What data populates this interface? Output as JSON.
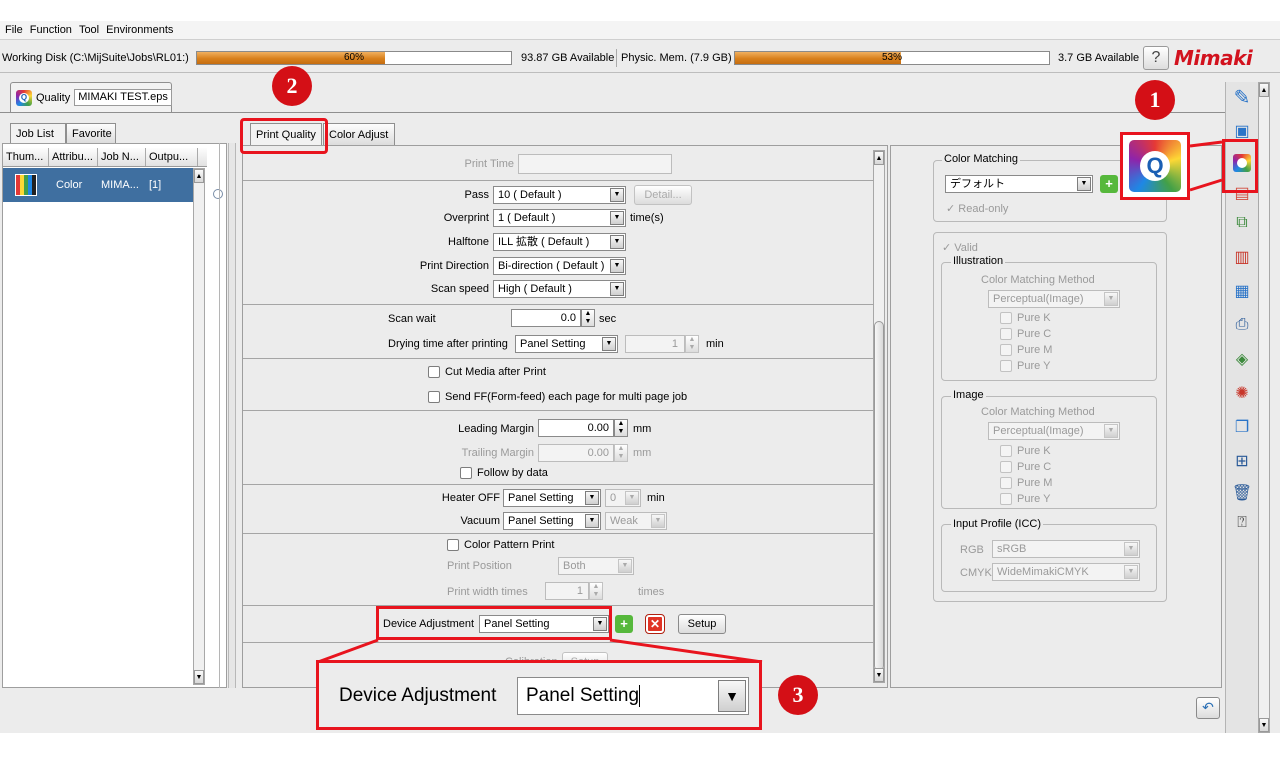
{
  "menu": [
    "File",
    "Function",
    "Tool",
    "Environments"
  ],
  "status": {
    "working_disk_label": "Working Disk (C:\\MijSuite\\Jobs\\RL01:)",
    "working_disk_percent_text": "60%",
    "working_disk_percent": 60,
    "working_disk_available": "93.87 GB Available",
    "phys_mem_label": "Physic. Mem. (7.9 GB)",
    "phys_mem_percent_text": "53%",
    "phys_mem_percent": 53,
    "phys_mem_available": "3.7 GB Available",
    "help_label": "?",
    "logo": "Mimaki"
  },
  "doc_tab": {
    "mode": "Quality",
    "filename": "MIMAKI TEST.eps"
  },
  "left_tabs": [
    "Job List",
    "Favorite"
  ],
  "job_list": {
    "columns": [
      "Thum...",
      "Attribu...",
      "Job N...",
      "Outpu..."
    ],
    "rows": [
      {
        "attribute": "Color",
        "job_name": "MIMA...",
        "output": "[1]"
      }
    ]
  },
  "center_tabs": [
    "Print Quality",
    "Color Adjust"
  ],
  "print_quality": {
    "print_time_label": "Print Time",
    "pass_label": "Pass",
    "pass_value": "10 ( Default )",
    "detail_button": "Detail...",
    "overprint_label": "Overprint",
    "overprint_value": "1 ( Default )",
    "overprint_unit": "time(s)",
    "halftone_label": "Halftone",
    "halftone_value": "ILL 拡散 ( Default )",
    "print_direction_label": "Print Direction",
    "print_direction_value": "Bi-direction ( Default )",
    "scan_speed_label": "Scan speed",
    "scan_speed_value": "High ( Default )",
    "scan_wait_label": "Scan wait",
    "scan_wait_value": "0.0",
    "scan_wait_unit": "sec",
    "drying_label": "Drying time after printing",
    "drying_value": "Panel Setting",
    "drying_minutes": "1",
    "drying_unit": "min",
    "cut_media_label": "Cut Media after Print",
    "send_ff_label": "Send FF(Form-feed) each page for multi page job",
    "leading_margin_label": "Leading Margin",
    "leading_margin_value": "0.00",
    "leading_margin_unit": "mm",
    "trailing_margin_label": "Trailing Margin",
    "trailing_margin_value": "0.00",
    "trailing_margin_unit": "mm",
    "follow_by_data_label": "Follow by data",
    "heater_off_label": "Heater OFF",
    "heater_off_value": "Panel Setting",
    "heater_off_minutes": "0",
    "heater_off_unit": "min",
    "vacuum_label": "Vacuum",
    "vacuum_value": "Panel Setting",
    "vacuum_level": "Weak",
    "color_pattern_label": "Color Pattern Print",
    "print_position_label": "Print Position",
    "print_position_value": "Both",
    "print_width_label": "Print width times",
    "print_width_value": "1",
    "print_width_unit": "times",
    "device_adjustment_label": "Device Adjustment",
    "device_adjustment_value": "Panel Setting",
    "setup_button": "Setup",
    "calibration_label": "Calibration",
    "calibration_button": "Setup"
  },
  "color_panel": {
    "color_matching_title": "Color Matching",
    "color_matching_value": "デフォルト",
    "read_only_label": "Read-only",
    "valid_label": "Valid",
    "illustration_title": "Illustration",
    "illustration_method_label": "Color Matching Method",
    "illustration_method_value": "Perceptual(Image)",
    "image_title": "Image",
    "image_method_label": "Color Matching Method",
    "image_method_value": "Perceptual(Image)",
    "pure_items": [
      "Pure K",
      "Pure C",
      "Pure M",
      "Pure Y"
    ],
    "input_profile_title": "Input Profile (ICC)",
    "rgb_label": "RGB",
    "rgb_value": "sRGB",
    "cmyk_label": "CMYK",
    "cmyk_value": "WideMimakiCMYK"
  },
  "callout": {
    "label": "Device Adjustment",
    "value": "Panel Setting"
  },
  "badges": [
    "1",
    "2",
    "3"
  ],
  "callout_icon_letter": "Q",
  "colors": {
    "accent_red": "#e8141e",
    "selection_blue": "#3f6fa0",
    "mimaki_red": "#d2121e",
    "progress_orange": "#d8801c"
  }
}
